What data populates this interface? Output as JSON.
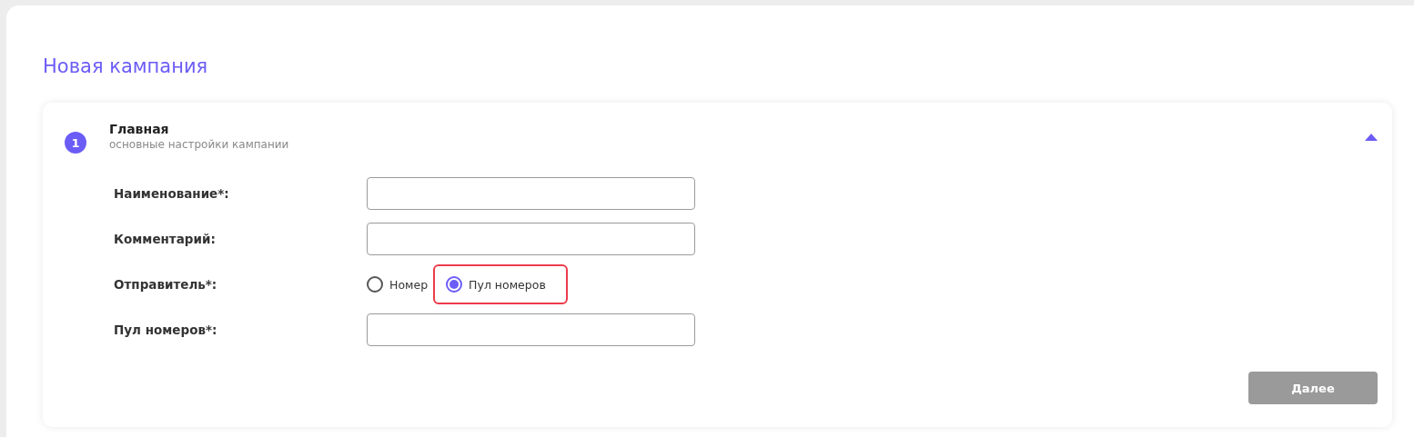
{
  "page": {
    "title": "Новая кампания"
  },
  "section": {
    "number": "1",
    "title": "Главная",
    "subtitle": "основные настройки кампании",
    "expanded": true
  },
  "fields": [
    {
      "kind": "text",
      "label": "Наименование*:"
    },
    {
      "kind": "text",
      "label": "Комментарий:"
    },
    {
      "kind": "radio",
      "label": "Отправитель*:",
      "options": [
        {
          "label": "Номер",
          "selected": false,
          "highlighted": false
        },
        {
          "label": "Пул номеров",
          "selected": true,
          "highlighted": true
        }
      ]
    },
    {
      "kind": "text",
      "label": "Пул номеров*:"
    }
  ],
  "next_button": {
    "label": "Далее",
    "disabled": true
  }
}
